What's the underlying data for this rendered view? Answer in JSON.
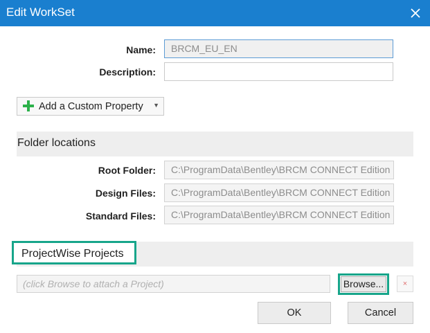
{
  "window": {
    "title": "Edit WorkSet"
  },
  "form": {
    "name_label": "Name:",
    "name_value": "BRCM_EU_EN",
    "description_label": "Description:",
    "description_value": ""
  },
  "custom_property": {
    "label": "Add a Custom Property"
  },
  "folder_locations": {
    "title": "Folder locations",
    "root_label": "Root Folder:",
    "root_value": "C:\\ProgramData\\Bentley\\BRCM CONNECT Edition",
    "design_label": "Design Files:",
    "design_value": "C:\\ProgramData\\Bentley\\BRCM CONNECT Edition",
    "standard_label": "Standard Files:",
    "standard_value": "C:\\ProgramData\\Bentley\\BRCM CONNECT Edition"
  },
  "projectwise": {
    "title": "ProjectWise Projects",
    "placeholder": "(click Browse to attach a Project)",
    "browse_label": "Browse...",
    "remove_symbol": "×"
  },
  "buttons": {
    "ok": "OK",
    "cancel": "Cancel"
  },
  "colors": {
    "titlebar": "#1a7fcf",
    "highlight": "#17a58a",
    "plus": "#2bb14a"
  },
  "icons": {
    "close": "close-icon",
    "plus": "plus-icon",
    "caret": "caret-down-icon",
    "remove": "remove-icon"
  }
}
